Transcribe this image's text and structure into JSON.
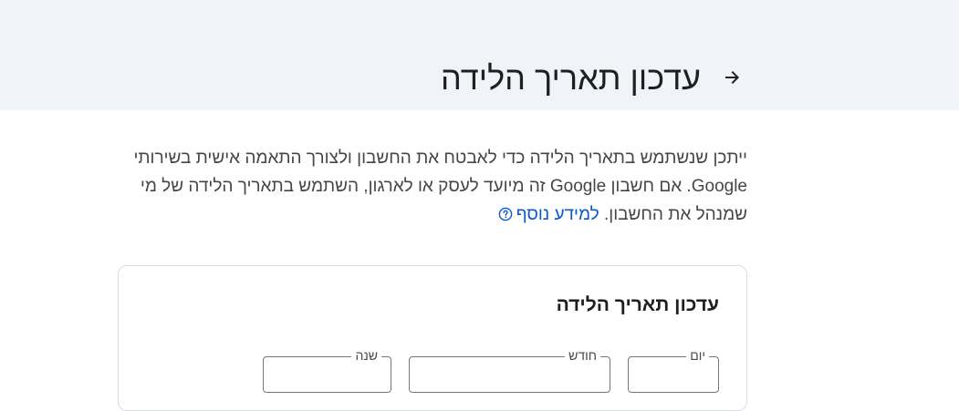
{
  "header": {
    "title": "עדכון תאריך הלידה",
    "back_icon": "arrow-back-icon",
    "background": "#f0f4f9"
  },
  "description": {
    "text": "ייתכן שנשתמש בתאריך הלידה כדי לאבטח את החשבון ולצורך התאמה אישית בשירותי Google. אם חשבון Google זה מיועד לעסק או לארגון, השתמש בתאריך הלידה של מי שמנהל את החשבון.",
    "learn_more": "למידע נוסף",
    "learn_more_icon": "help-circle-icon",
    "link_color": "#0b57d0"
  },
  "card": {
    "title": "עדכון תאריך הלידה",
    "fields": {
      "day_label": "יום",
      "month_label": "חודש",
      "year_label": "שנה"
    }
  }
}
